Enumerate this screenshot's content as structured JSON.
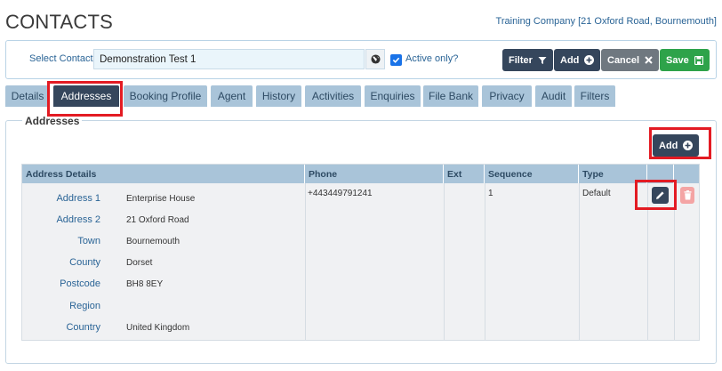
{
  "header": {
    "title": "CONTACTS",
    "company": "Training Company [21 Oxford Road, Bournemouth]"
  },
  "contact_bar": {
    "select_label": "Select Contact",
    "contact_value": "Demonstration Test 1",
    "active_only_label": "Active only?",
    "active_only_checked": true,
    "filter_label": "Filter",
    "add_label": "Add",
    "cancel_label": "Cancel",
    "save_label": "Save"
  },
  "tabs": [
    {
      "label": "Details"
    },
    {
      "label": "Addresses",
      "active": true
    },
    {
      "label": "Booking Profile"
    },
    {
      "label": "Agent"
    },
    {
      "label": "History"
    },
    {
      "label": "Activities"
    },
    {
      "label": "Enquiries"
    },
    {
      "label": "File Bank"
    },
    {
      "label": "Privacy"
    },
    {
      "label": "Audit"
    },
    {
      "label": "Filters"
    }
  ],
  "addresses": {
    "panel_title": "Addresses",
    "add_label": "Add",
    "columns": [
      "Address Details",
      "Phone",
      "Ext",
      "Sequence",
      "Type"
    ],
    "row": {
      "phone": "+443449791241",
      "ext": "",
      "sequence": "1",
      "type": "Default",
      "fields": [
        {
          "label": "Address 1",
          "value": "Enterprise House"
        },
        {
          "label": "Address 2",
          "value": "21 Oxford Road"
        },
        {
          "label": "Town",
          "value": "Bournemouth"
        },
        {
          "label": "County",
          "value": "Dorset"
        },
        {
          "label": "Postcode",
          "value": "BH8 8EY"
        },
        {
          "label": "Region",
          "value": ""
        },
        {
          "label": "Country",
          "value": "United Kingdom"
        }
      ]
    }
  },
  "colors": {
    "primary_dark": "#35465c",
    "tab_bg": "#a9c4d9",
    "highlight": "#e31b23",
    "save_green": "#2ea34a",
    "delete_pink": "#f4a4a4",
    "link_blue": "#2a6496"
  },
  "icons": {
    "filter": "filter-icon",
    "add": "plus-circle-icon",
    "cancel": "close-icon",
    "save": "save-icon",
    "globe": "globe-icon",
    "edit": "pencil-icon",
    "delete": "trash-icon"
  }
}
